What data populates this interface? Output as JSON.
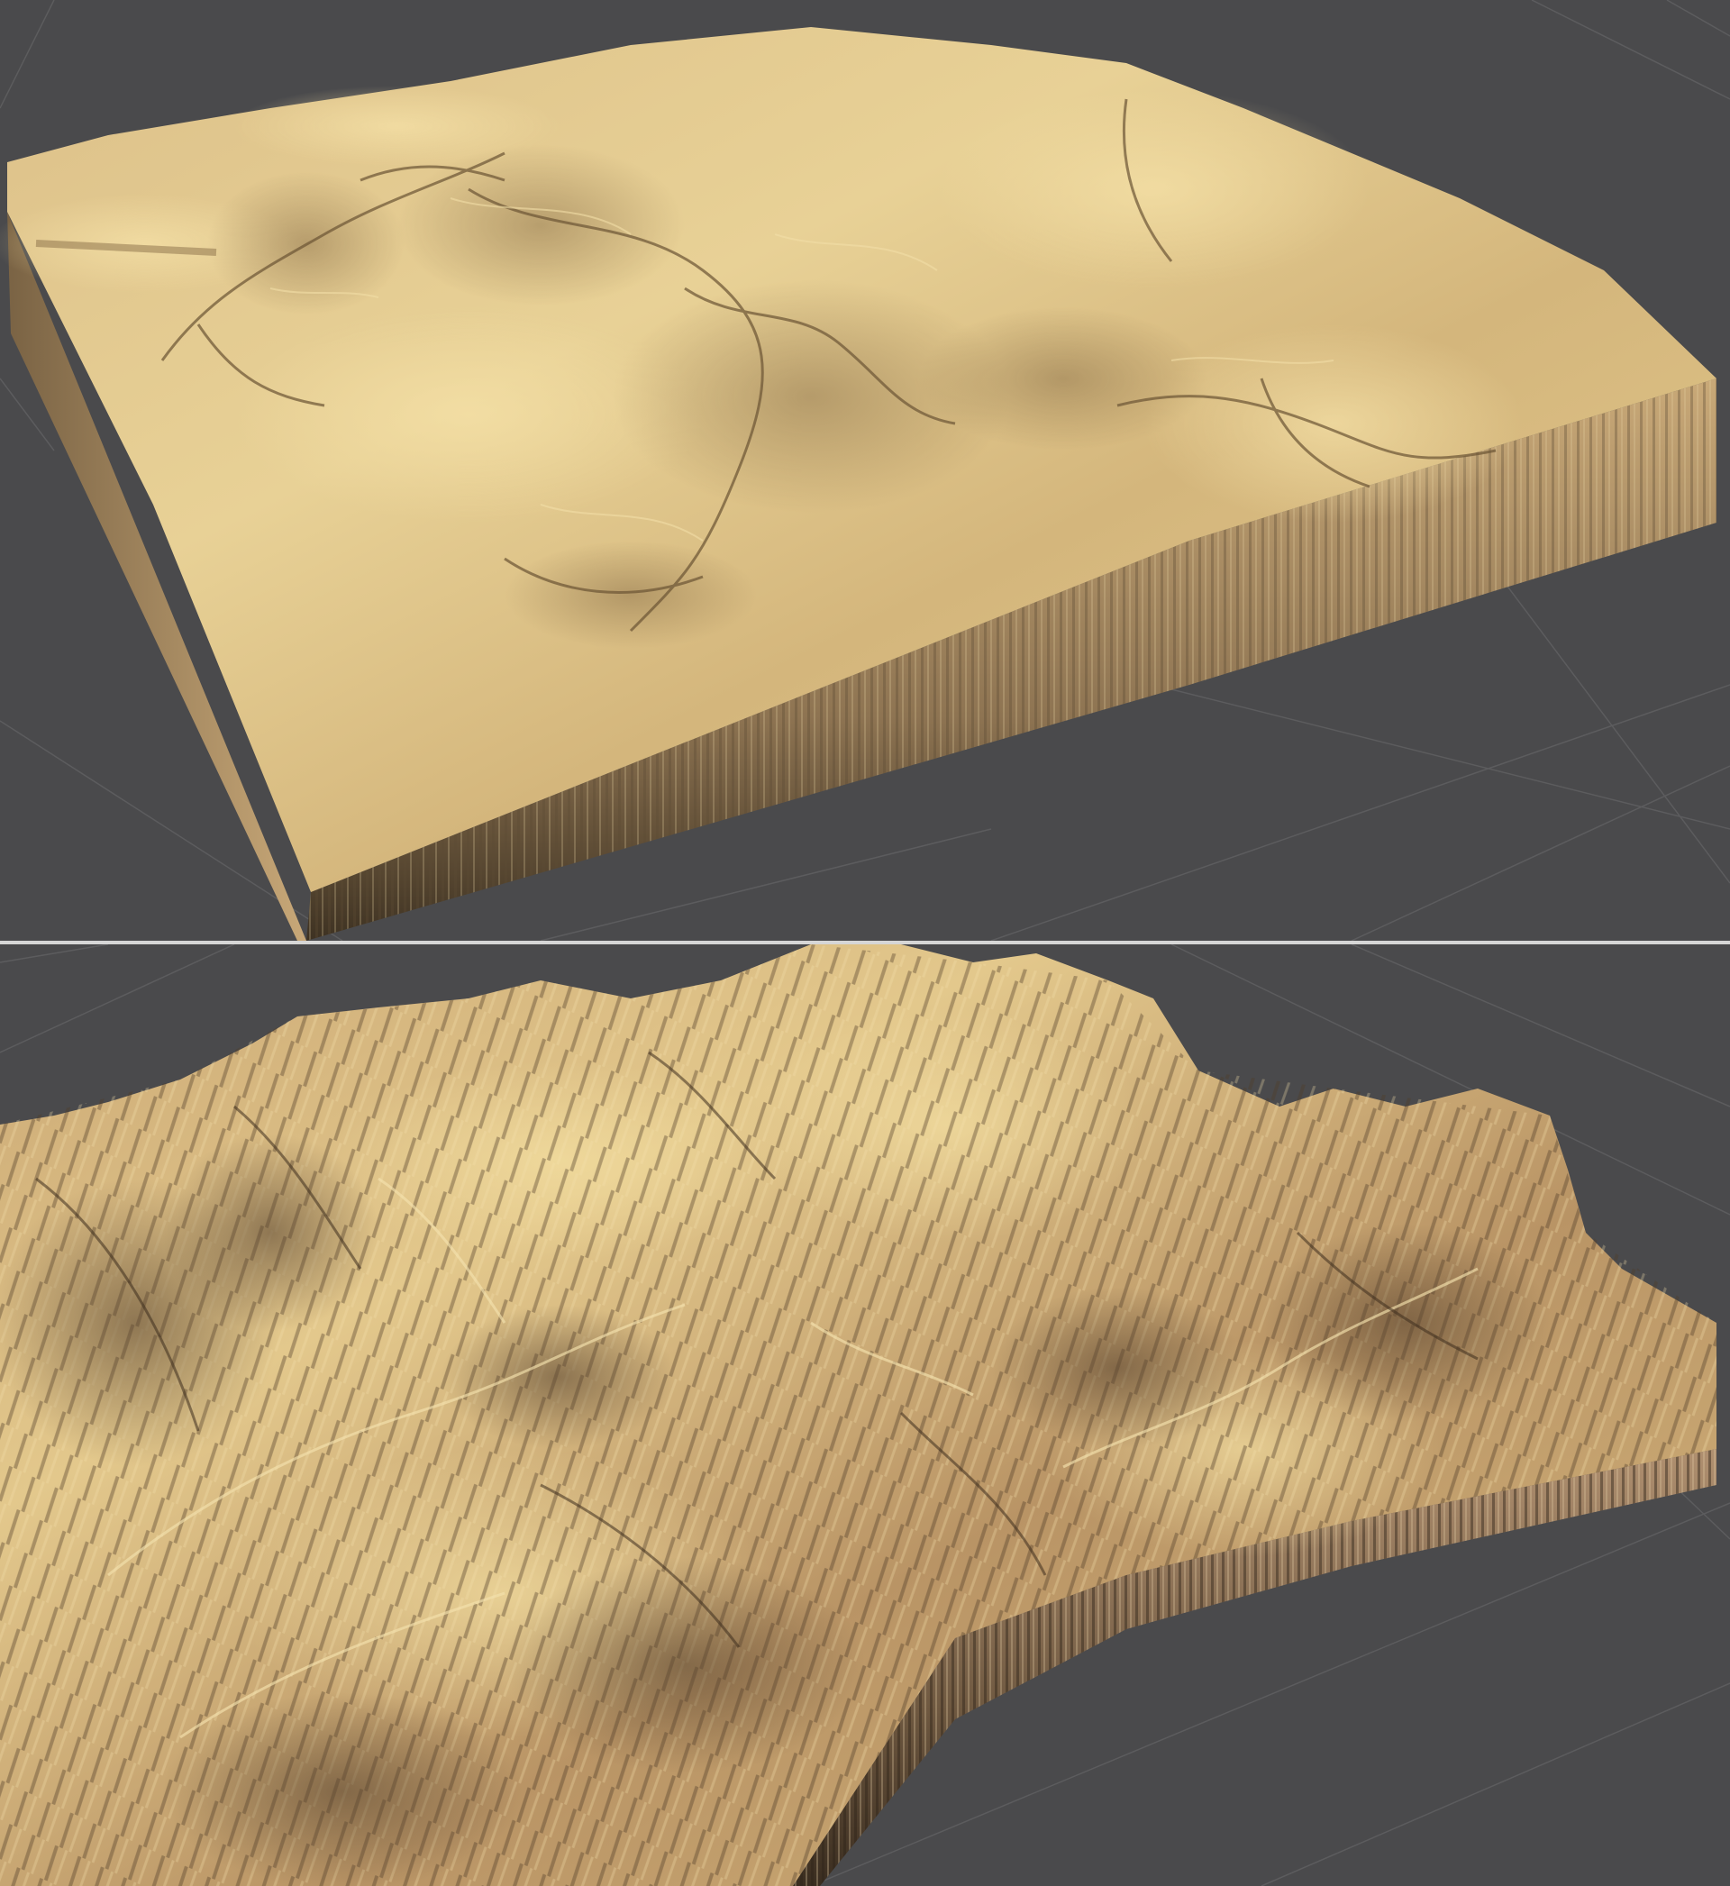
{
  "viewports": [
    {
      "id": "top",
      "terrain": "flat-plateau",
      "colors": {
        "background": "#4a4a4c",
        "grid": "#5c5c5e",
        "surface_light": "#ead394",
        "surface_mid": "#d6b979",
        "surface_dark": "#8a6f48",
        "cliff_light": "#b89b70",
        "cliff_dark": "#3e3222"
      }
    },
    {
      "id": "bottom",
      "terrain": "eroded-mountains",
      "colors": {
        "background": "#4a4a4c",
        "grid": "#5c5c5e",
        "surface_light": "#e9cf8e",
        "surface_mid": "#c9a673",
        "surface_dark": "#5a4530",
        "cliff_light": "#b09070",
        "cliff_dark": "#3a2d20"
      }
    }
  ],
  "divider_color": "#d6d6d6"
}
